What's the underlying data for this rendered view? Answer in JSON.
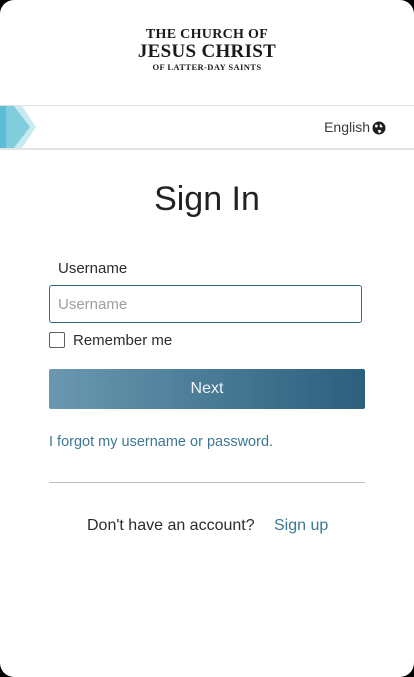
{
  "logo": {
    "line1": "THE CHURCH OF",
    "line2": "JESUS CHRIST",
    "line3": "OF LATTER-DAY SAINTS"
  },
  "language": {
    "label": "English",
    "icon": "globe-icon"
  },
  "form": {
    "title": "Sign In",
    "username_label": "Username",
    "username_placeholder": "Username",
    "username_value": "",
    "remember_label": "Remember me",
    "remember_checked": false,
    "next_label": "Next",
    "forgot_link": "I forgot my username or password."
  },
  "footer": {
    "no_account_text": "Don't have an account?",
    "signup_link": "Sign up"
  },
  "colors": {
    "link": "#3c7893",
    "input_border": "#2e6c80",
    "button_start": "#6b98b0",
    "button_end": "#2b5f7d"
  }
}
